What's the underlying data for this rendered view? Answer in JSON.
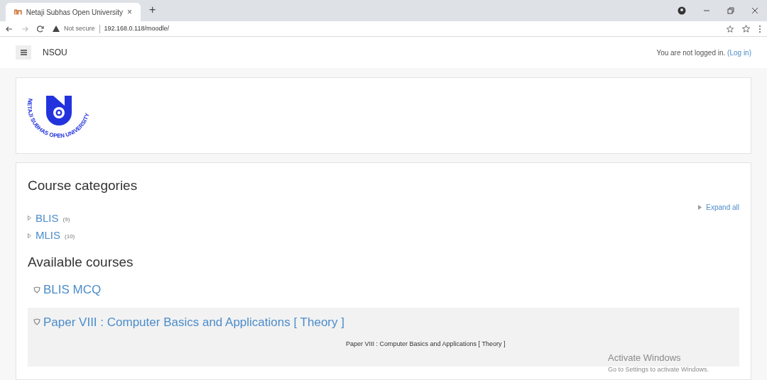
{
  "browser": {
    "tab_title": "Netaji Subhas Open University",
    "tab_close": "×",
    "new_tab": "+",
    "security": "Not secure",
    "url": "192.168.0.118/moodle/"
  },
  "navbar": {
    "brand": "NSOU",
    "login_text": "You are not logged in.",
    "login_link": "(Log in)"
  },
  "logo": {
    "text": "NETAJI SUBHAS OPEN UNIVERSITY"
  },
  "categories": {
    "heading": "Course categories",
    "expand_all": "Expand all",
    "items": [
      {
        "name": "BLIS",
        "count": "(9)"
      },
      {
        "name": "MLIS",
        "count": "(10)"
      }
    ]
  },
  "courses": {
    "heading": "Available courses",
    "items": [
      {
        "name": "BLIS MCQ",
        "highlighted": false
      },
      {
        "name": "Paper VIII : Computer Basics and Applications [ Theory ]",
        "highlighted": true,
        "summary": "Paper VIII : Computer Basics and Applications [ Theory ]"
      }
    ]
  },
  "os_notice": {
    "title": "Activate Windows",
    "subtitle": "Go to Settings to activate Windows."
  }
}
